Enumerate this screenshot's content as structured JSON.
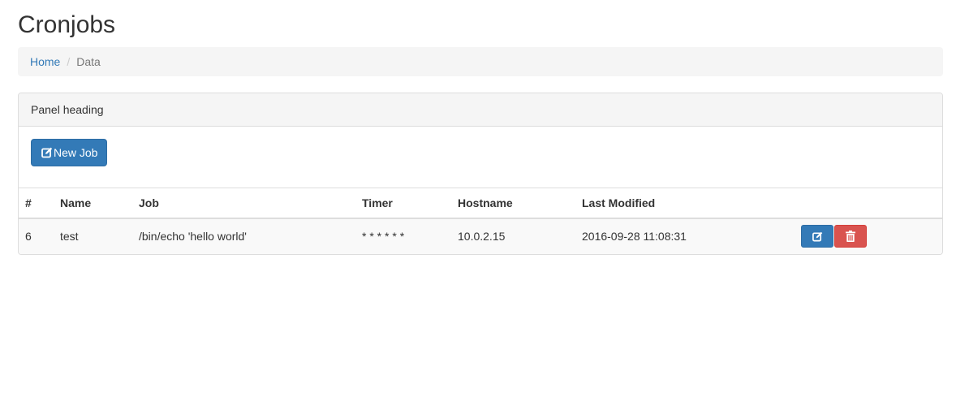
{
  "page": {
    "title": "Cronjobs"
  },
  "breadcrumb": {
    "home": "Home",
    "separator": "/",
    "current": "Data"
  },
  "panel": {
    "heading": "Panel heading"
  },
  "toolbar": {
    "new_job_label": "New Job",
    "new_job_icon": "edit-icon"
  },
  "table": {
    "headers": {
      "id": "#",
      "name": "Name",
      "job": "Job",
      "timer": "Timer",
      "hostname": "Hostname",
      "last_modified": "Last Modified"
    },
    "rows": [
      {
        "id": "6",
        "name": "test",
        "job": "/bin/echo 'hello world'",
        "timer": "* * * * * *",
        "hostname": "10.0.2.15",
        "last_modified": "2016-09-28 11:08:31",
        "actions": {
          "edit_icon": "edit-icon",
          "delete_icon": "trash-icon"
        }
      }
    ]
  },
  "colors": {
    "primary": "#337ab7",
    "danger": "#d9534f",
    "link": "#337ab7"
  }
}
